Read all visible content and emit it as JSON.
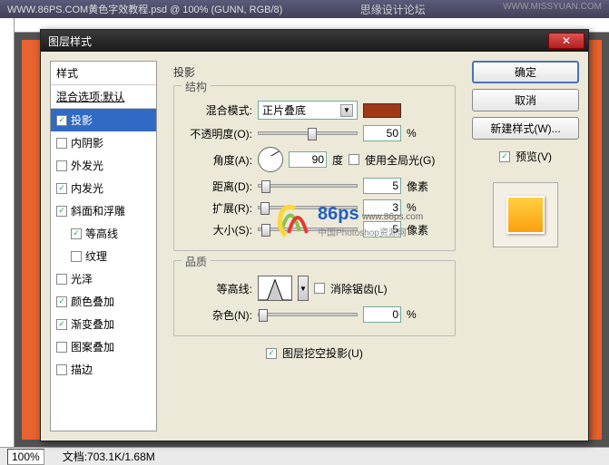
{
  "app": {
    "title": "WWW.86PS.COM黄色字效教程.psd @ 100% (GUNN, RGB/8)",
    "forum_name": "思缘设计论坛",
    "watermark": "WWW.MISSYUAN.COM"
  },
  "statusbar": {
    "zoom": "100%",
    "doc": "文档:703.1K/1.68M"
  },
  "dialog": {
    "title": "图层样式",
    "close": "✕",
    "styles_header": "样式",
    "blend_options": "混合选项:默认",
    "items": [
      {
        "label": "投影",
        "checked": true,
        "selected": true
      },
      {
        "label": "内阴影",
        "checked": false
      },
      {
        "label": "外发光",
        "checked": false
      },
      {
        "label": "内发光",
        "checked": true
      },
      {
        "label": "斜面和浮雕",
        "checked": true
      },
      {
        "label": "等高线",
        "checked": true,
        "indent": true
      },
      {
        "label": "纹理",
        "checked": false,
        "indent": true
      },
      {
        "label": "光泽",
        "checked": false
      },
      {
        "label": "颜色叠加",
        "checked": true
      },
      {
        "label": "渐变叠加",
        "checked": true
      },
      {
        "label": "图案叠加",
        "checked": false
      },
      {
        "label": "描边",
        "checked": false
      }
    ],
    "main_title": "投影",
    "structure": {
      "legend": "结构",
      "blend_mode_label": "混合模式:",
      "blend_mode_value": "正片叠底",
      "opacity_label": "不透明度(O):",
      "opacity_value": "50",
      "pct": "%",
      "angle_label": "角度(A):",
      "angle_value": "90",
      "angle_unit": "度",
      "global_light": "使用全局光(G)",
      "distance_label": "距离(D):",
      "distance_value": "5",
      "px": "像素",
      "spread_label": "扩展(R):",
      "spread_value": "3",
      "size_label": "大小(S):",
      "size_value": "5"
    },
    "quality": {
      "legend": "品质",
      "contour_label": "等高线:",
      "antialias": "消除锯齿(L)",
      "noise_label": "杂色(N):",
      "noise_value": "0"
    },
    "knockout": "图层挖空投影(U)",
    "buttons": {
      "ok": "确定",
      "cancel": "取消",
      "new_style": "新建样式(W)...",
      "preview": "预览(V)"
    }
  },
  "logo": {
    "brand": "86ps",
    "url": "www.86ps.com",
    "tagline": "中国Photoshop资源网"
  }
}
